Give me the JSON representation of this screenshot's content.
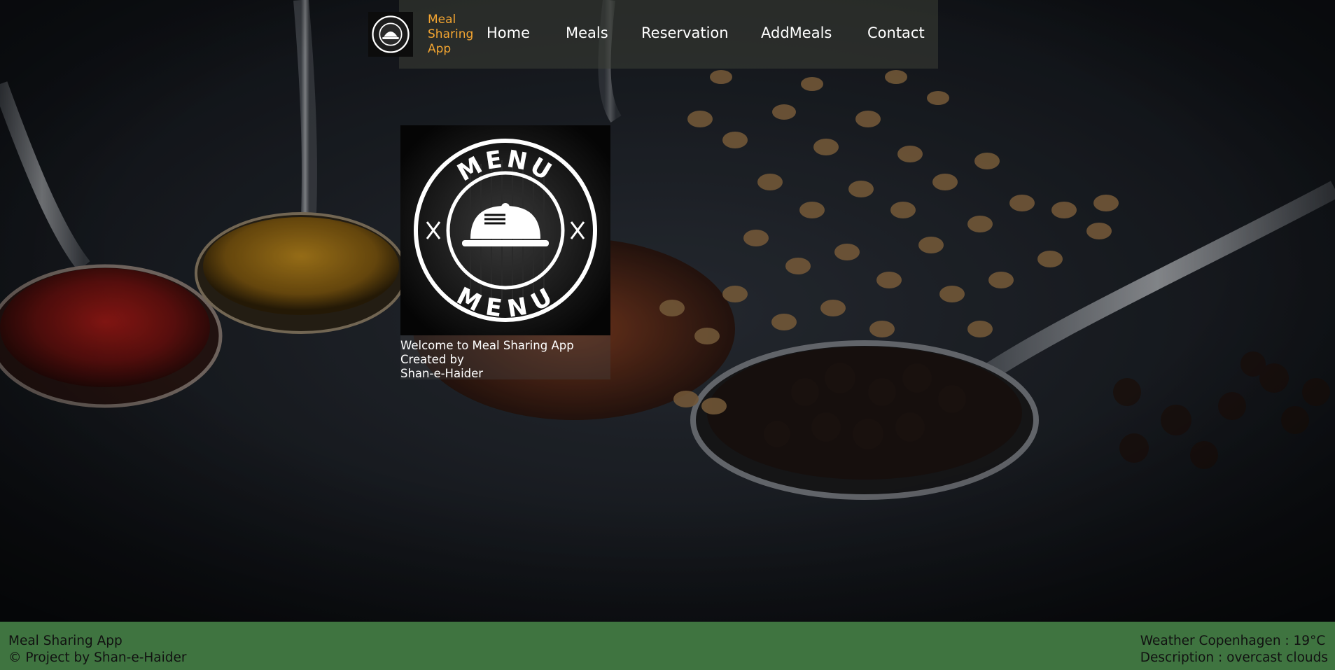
{
  "header": {
    "brand": [
      "Meal",
      "Sharing",
      "App"
    ],
    "nav": [
      {
        "label": "Home"
      },
      {
        "label": "Meals"
      },
      {
        "label": "Reservation"
      },
      {
        "label": "AddMeals"
      },
      {
        "label": "Contact"
      }
    ]
  },
  "logo": {
    "top_text": "MENU",
    "bottom_text": "MENU",
    "icon": "cloche-icon"
  },
  "welcome": {
    "line1": "Welcome to Meal Sharing App",
    "line2": "Created by",
    "line3": "Shan-e-Haider"
  },
  "footer": {
    "left_line1": "Meal Sharing App",
    "left_line2": "© Project by Shan-e-Haider",
    "right_line1": "Weather Copenhagen : 19°C",
    "right_line2": "Description : overcast clouds"
  },
  "colors": {
    "brand": "#f3a531",
    "footer": "#3f7440"
  }
}
